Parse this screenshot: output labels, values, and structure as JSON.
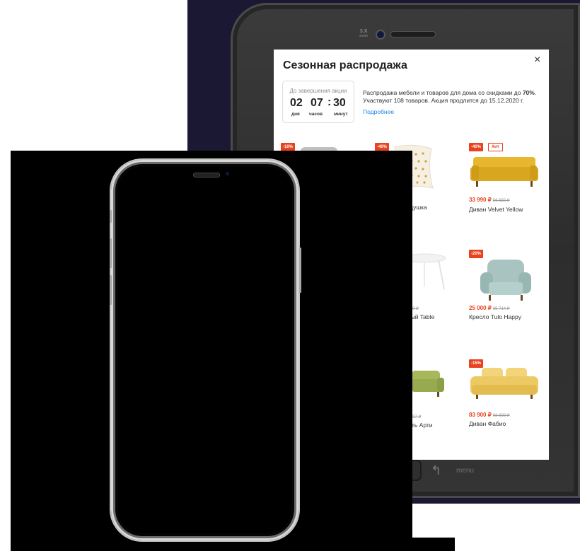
{
  "tablet": {
    "zoom_label": "3.X",
    "zoom_sub": "zoom",
    "menu_label": "menu",
    "back_icon": "back-arrow-icon"
  },
  "popup": {
    "title": "Сезонная распродажа",
    "close_glyph": "×",
    "timer": {
      "label": "До завершения акции",
      "days": "02",
      "hours": "07",
      "minutes": "30",
      "separator": ":",
      "days_unit": "дня",
      "hours_unit": "часов",
      "minutes_unit": "минут"
    },
    "description_line1_prefix": "Распродажа мебели и товаров для дома со скидками до ",
    "description_highlight": "70%",
    "description_line1_suffix": ".",
    "description_line2": "Участвуют 108 товаров. Акция продлится до 15.12.2020 г.",
    "more_link": "Подробнее"
  },
  "products": [
    {
      "badge": "-10%",
      "price": "",
      "old_price": "",
      "name": ""
    },
    {
      "badge": "-40%",
      "price": "",
      "old_price": "",
      "name": "я подушка"
    },
    {
      "badge": "-40%",
      "badge2": "Хит",
      "price": "33 990 ₽",
      "old_price": "56 650 ₽",
      "name": "Диван Velvet Yellow"
    },
    {
      "badge": "",
      "price": "",
      "old_price": "0 ₽",
      "name": "ный Table"
    },
    {
      "badge": "-20%",
      "price": "25 000 ₽",
      "old_price": "35 714 ₽",
      "name": "Кресло Tulo Happy"
    },
    {
      "badge": "",
      "price": "",
      "old_price": "97 ₽",
      "name": "ть Арти"
    },
    {
      "badge": "-15%",
      "price": "83 900 ₽",
      "old_price": "98 699 ₽",
      "name": "Диван Фабио"
    }
  ],
  "colors": {
    "accent": "#e8421e",
    "link": "#1e88e5",
    "backdrop": "#1a1832"
  }
}
